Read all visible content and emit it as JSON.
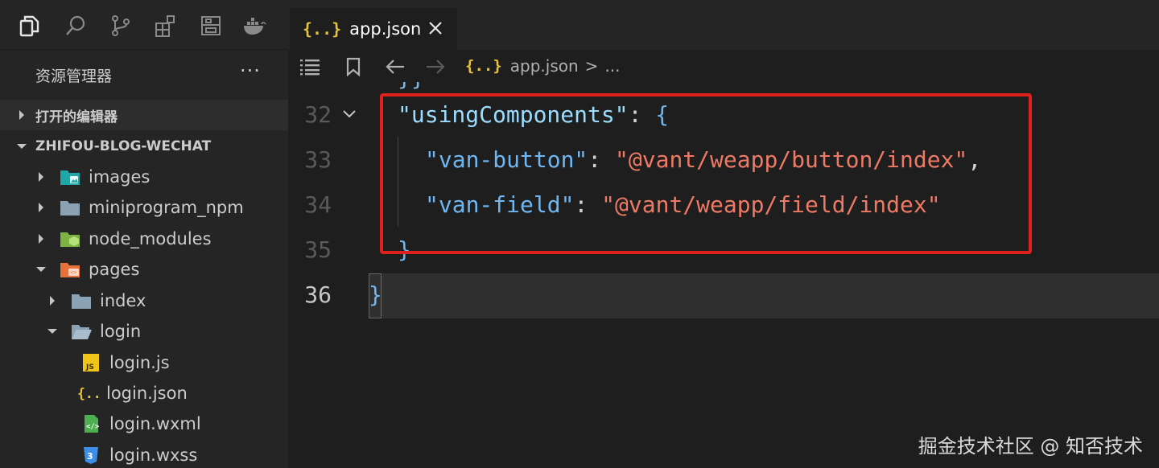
{
  "activity_bar": {
    "icons": [
      "explorer-icon",
      "search-icon",
      "source-control-icon",
      "extensions-icon",
      "layout-icon",
      "docker-icon"
    ]
  },
  "sidebar": {
    "title": "资源管理器",
    "more": "···",
    "open_editors": "打开的编辑器",
    "project": "ZHIFOU-BLOG-WECHAT",
    "tree": [
      {
        "label": "images",
        "icon": "images-folder-icon"
      },
      {
        "label": "miniprogram_npm",
        "icon": "folder-icon"
      },
      {
        "label": "node_modules",
        "icon": "node-folder-icon"
      },
      {
        "label": "pages",
        "icon": "pages-folder-icon"
      },
      {
        "label": "index",
        "icon": "folder-icon"
      },
      {
        "label": "login",
        "icon": "folder-open-icon"
      },
      {
        "label": "login.js",
        "icon": "js-file-icon"
      },
      {
        "label": "login.json",
        "icon": "json-file-icon"
      },
      {
        "label": "login.wxml",
        "icon": "wxml-file-icon"
      },
      {
        "label": "login.wxss",
        "icon": "css-file-icon"
      }
    ]
  },
  "tabs": {
    "active": {
      "glyph": "{..}",
      "label": "app.json"
    }
  },
  "breadcrumb": {
    "glyph": "{..}",
    "file": "app.json",
    "sep": ">",
    "rest": "..."
  },
  "editor": {
    "lines": [
      {
        "no": "32"
      },
      {
        "no": "33"
      },
      {
        "no": "34"
      },
      {
        "no": "35"
      },
      {
        "no": "36"
      }
    ],
    "code": {
      "l32_key": "\"usingComponents\"",
      "l32_colon": ": ",
      "l32_brace": "{",
      "l33_key": "\"van-button\"",
      "l33_colon": ": ",
      "l33_val": "\"@vant/weapp/button/index\"",
      "l33_comma": ",",
      "l34_key": "\"van-field\"",
      "l34_colon": ": ",
      "l34_val": "\"@vant/weapp/field/index\"",
      "l35_brace": "}",
      "l36_brace": "}",
      "partial_top": "}}"
    }
  },
  "watermark": "掘金技术社区 @ 知否技术",
  "colors": {
    "highlight_box": "#e0201c",
    "json_key": "#9cdcfe",
    "json_string": "#ee7965",
    "json_glyph": "#e8c13a"
  }
}
